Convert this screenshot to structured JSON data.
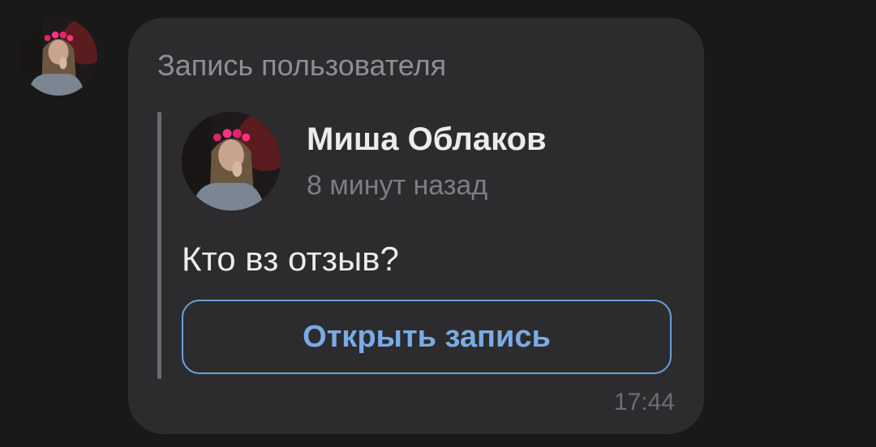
{
  "message": {
    "header": "Запись пользователя",
    "time": "17:44",
    "post": {
      "author": "Миша Облаков",
      "posted_ago": "8 минут назад",
      "text": "Кто вз отзыв?",
      "open_button_label": "Открыть запись"
    }
  },
  "colors": {
    "background": "#19191a",
    "bubble": "#2c2c2e",
    "accent": "#7aabe6",
    "accent_border": "#6f9fd8",
    "primary_text": "#ececee",
    "secondary_text": "#8e8e93"
  },
  "icons": {
    "sender_avatar": "user-avatar-icon",
    "post_avatar": "user-avatar-icon"
  }
}
